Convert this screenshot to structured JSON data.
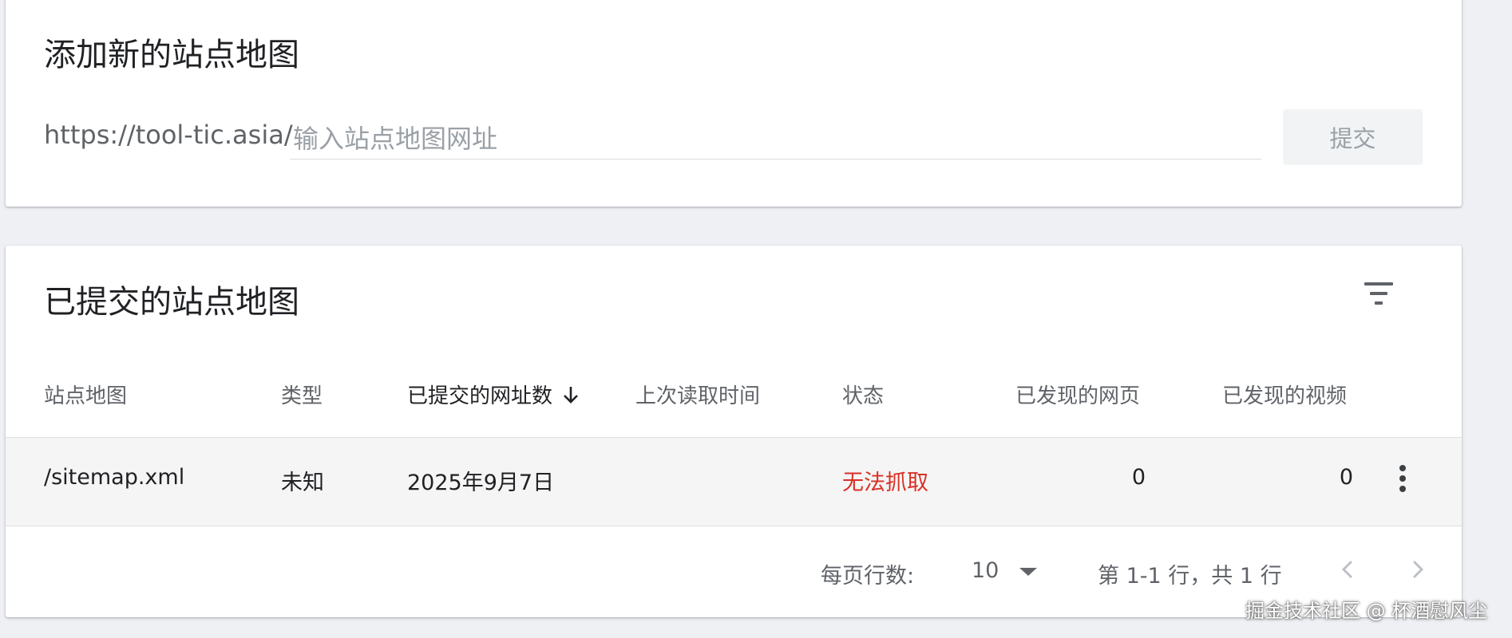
{
  "add_sitemap": {
    "title": "添加新的站点地图",
    "url_prefix": "https://tool-tic.asia/",
    "input_placeholder": "输入站点地图网址",
    "input_value": "",
    "submit_label": "提交"
  },
  "submitted": {
    "title": "已提交的站点地图",
    "filter_icon": "filter-icon",
    "columns": [
      "站点地图",
      "类型",
      "已提交的网址数",
      "上次读取时间",
      "状态",
      "已发现的网页",
      "已发现的视频"
    ],
    "sorted_column_icon": "arrow-down-icon",
    "rows": [
      {
        "sitemap": "/sitemap.xml",
        "type": "未知",
        "submitted": "2025年9月7日",
        "last_read": "",
        "status": "无法抓取",
        "pages": "0",
        "videos": "0"
      }
    ],
    "pagination": {
      "rows_per_page_label": "每页行数:",
      "rows_per_page": "10",
      "range": "第 1-1 行，共 1 行"
    }
  },
  "watermark": "掘金技术社区 @ 杯酒慰风尘",
  "colors": {
    "background": "#eef0f4",
    "error": "#d93025",
    "row_bg": "#f5f5f5"
  }
}
